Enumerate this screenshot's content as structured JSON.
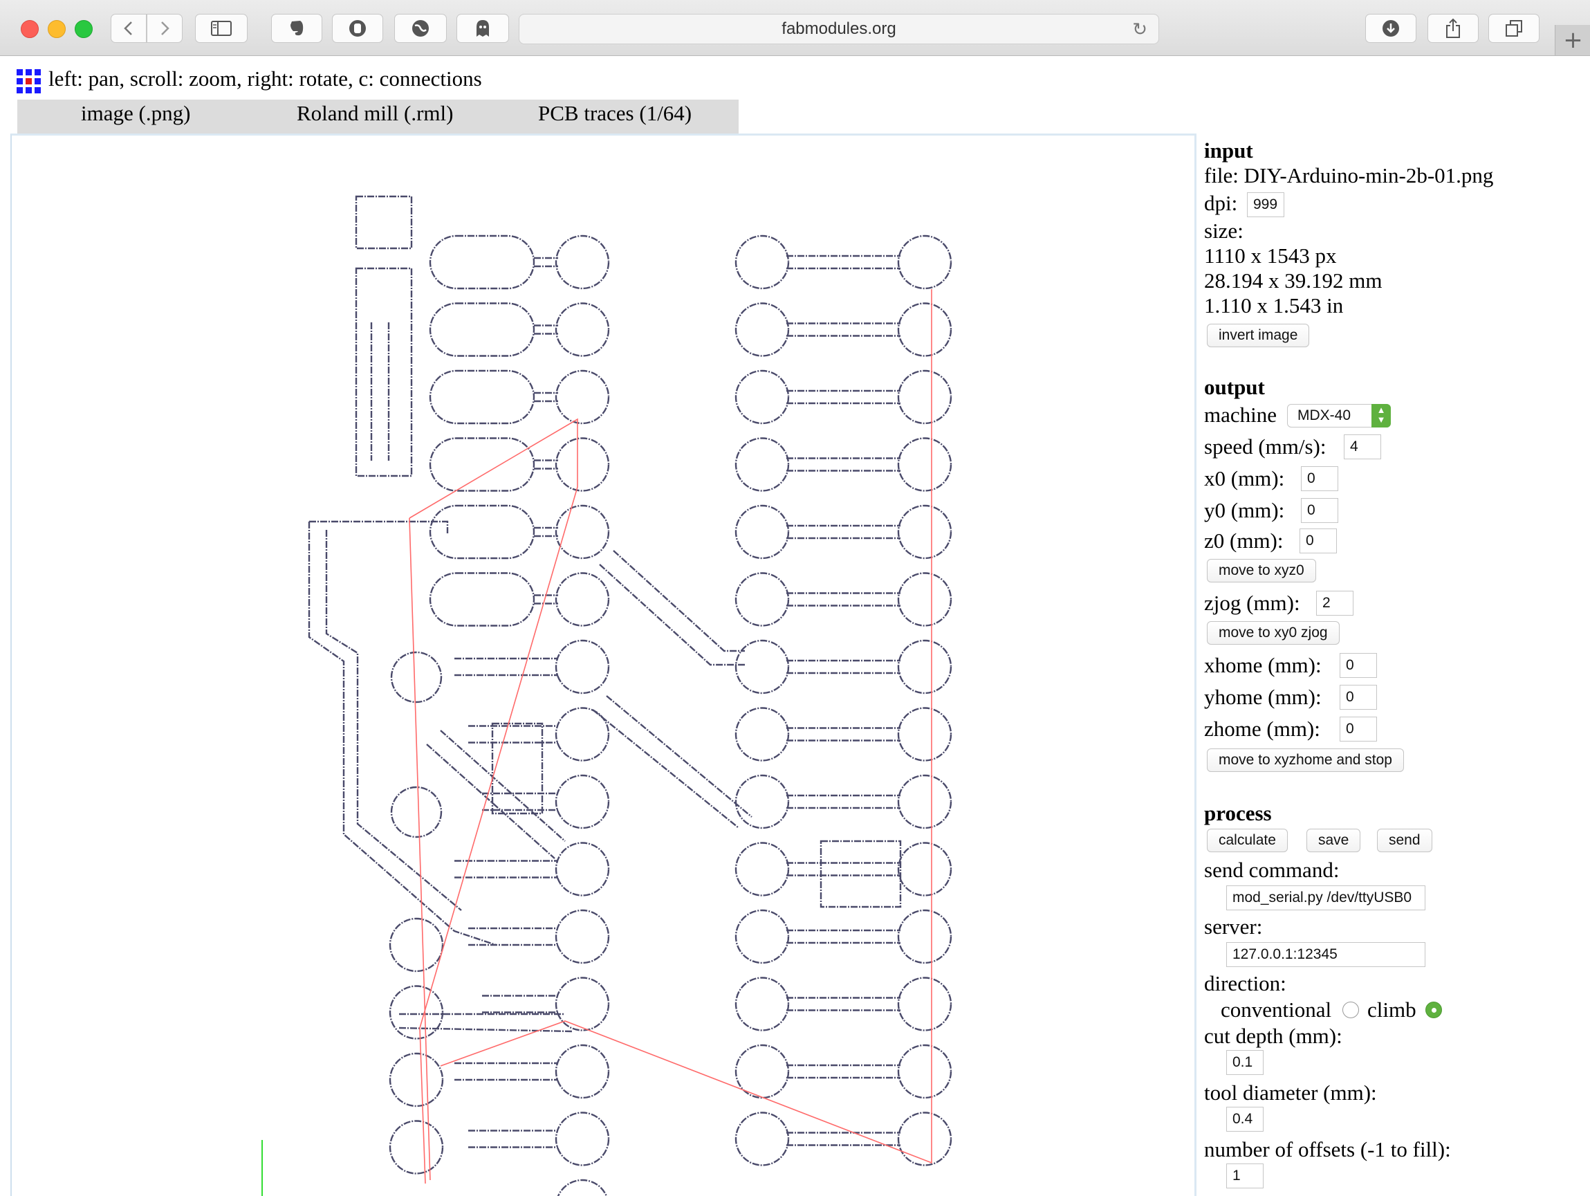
{
  "browser": {
    "url": "fabmodules.org",
    "new_tab_symbol": "+"
  },
  "page": {
    "help_text": "left: pan, scroll: zoom, right: rotate, c: connections",
    "menus": [
      "image (.png)",
      "Roland mill (.rml)",
      "PCB traces (1/64)"
    ]
  },
  "input": {
    "heading": "input",
    "file": "file: DIY-Arduino-min-2b-01.png",
    "dpi_label": "dpi:",
    "dpi_value": "999",
    "size_label": "size:",
    "size_px": "1110 x 1543 px",
    "size_mm": "28.194 x 39.192 mm",
    "size_in": "1.110 x 1.543 in",
    "invert_button": "invert image"
  },
  "output": {
    "heading": "output",
    "machine_label": "machine",
    "machine_value": "MDX-40",
    "speed_label": "speed (mm/s):",
    "speed_value": "4",
    "x0_label": "x0 (mm):",
    "x0_value": "0",
    "y0_label": "y0 (mm):",
    "y0_value": "0",
    "z0_label": "z0 (mm):",
    "z0_value": "0",
    "move_xyz0_button": "move to xyz0",
    "zjog_label": "zjog (mm):",
    "zjog_value": "2",
    "move_xy0_button": "move to xy0 zjog",
    "xhome_label": "xhome (mm):",
    "xhome_value": "0",
    "yhome_label": "yhome (mm):",
    "yhome_value": "0",
    "zhome_label": "zhome (mm):",
    "zhome_value": "0",
    "move_home_button": "move to xyzhome and stop"
  },
  "process": {
    "heading": "process",
    "calculate_button": "calculate",
    "save_button": "save",
    "send_button": "send",
    "send_command_label": "send command:",
    "send_command_value": "mod_serial.py /dev/ttyUSB0",
    "server_label": "server:",
    "server_value": "127.0.0.1:12345",
    "direction_label": "direction:",
    "conventional_label": "conventional",
    "climb_label": "climb",
    "direction_selected": "climb",
    "cut_depth_label": "cut depth (mm):",
    "cut_depth_value": "0.1",
    "tool_diameter_label": "tool diameter (mm):",
    "tool_diameter_value": "0.4",
    "offsets_label": "number of offsets (-1 to fill):",
    "offsets_value": "1"
  },
  "colors": {
    "trace": "#4a4a6a",
    "connection": "#ff6a6a",
    "accent_green": "#5fb13f"
  }
}
